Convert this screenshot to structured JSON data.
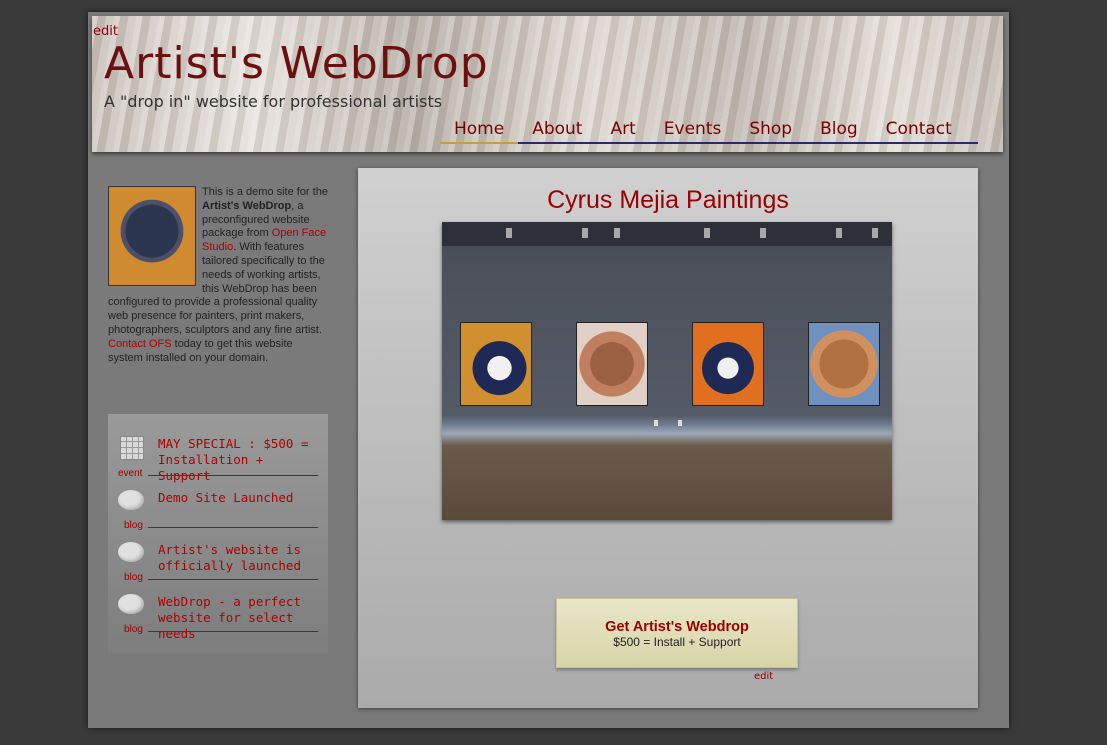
{
  "header": {
    "edit_label": "edit",
    "site_title": "Artist's WebDrop",
    "tagline": "A \"drop in\" website for professional artists"
  },
  "nav": {
    "items": [
      {
        "label": "Home",
        "active": true
      },
      {
        "label": "About"
      },
      {
        "label": "Art"
      },
      {
        "label": "Events"
      },
      {
        "label": "Shop"
      },
      {
        "label": "Blog"
      },
      {
        "label": "Contact"
      }
    ]
  },
  "sidebar": {
    "intro": {
      "text_1": "This is a demo site for the ",
      "bold": "Artist's WebDrop",
      "text_2": ", a preconfigured website package from ",
      "link_1": "Open Face Studio",
      "text_3": ". With features tailored specifically to the needs of working artists, this WebDrop has been configured to provide a professional quality web presence for painters, print makers, photographers, sculptors and any fine artist. ",
      "link_2": "Contact OFS",
      "text_4": " today to get this website system installed on your domain."
    },
    "news": [
      {
        "icon": "calendar-icon",
        "type": "event",
        "title": "MAY SPECIAL : $500 = Installation + Support"
      },
      {
        "icon": "speech-bubble-icon",
        "type": "blog",
        "title": "Demo Site Launched"
      },
      {
        "icon": "speech-bubble-icon",
        "type": "blog",
        "title": "Artist's website is officially launched"
      },
      {
        "icon": "speech-bubble-icon",
        "type": "blog",
        "title": "WebDrop - a perfect website for select needs"
      }
    ]
  },
  "main": {
    "title": "Cyrus Mejia Paintings",
    "cta": {
      "title": "Get Artist's Webdrop",
      "subtitle": "$500 = Install + Support"
    },
    "edit_label": "edit"
  },
  "colors": {
    "accent": "#9a0000",
    "background": "#3a3a3a",
    "nav_underline": "#2a2a6a"
  }
}
